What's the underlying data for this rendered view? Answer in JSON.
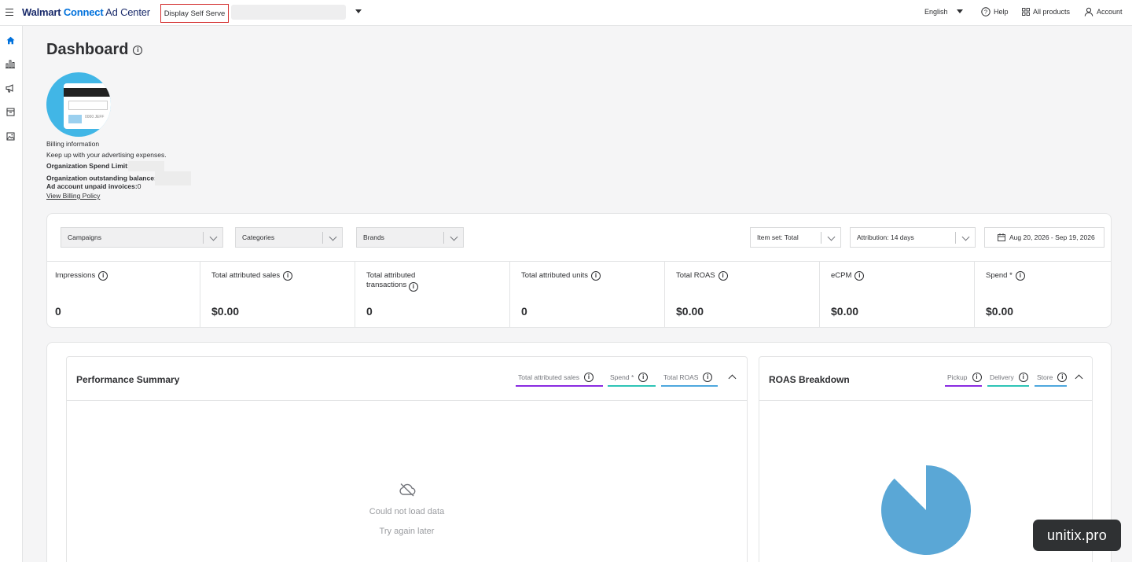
{
  "topbar": {
    "brand_walmart": "Walmart",
    "brand_connect": "Connect",
    "brand_adcenter": "Ad Center",
    "product_selector": "Display Self Serve",
    "language": "English",
    "help": "Help",
    "all_products": "All products",
    "account": "Account"
  },
  "sidebar": {
    "items": [
      {
        "icon": "home-icon"
      },
      {
        "icon": "bar-chart-icon"
      },
      {
        "icon": "megaphone-icon"
      },
      {
        "icon": "inventory-icon"
      },
      {
        "icon": "image-icon"
      }
    ]
  },
  "dashboard": {
    "title": "Dashboard",
    "billing": {
      "card_text": "0000 JEFF",
      "label": "Billing information",
      "description": "Keep up with your advertising expenses.",
      "spend_limit_label": "Organization Spend Limit:",
      "outstanding_label": "Organization outstanding balance:",
      "unpaid_label": "Ad account unpaid invoices:",
      "unpaid_value": "0",
      "policy_link": "View Billing Policy"
    },
    "filters": {
      "campaigns": "Campaigns",
      "categories": "Categories",
      "brands": "Brands",
      "item_set": "Item set: Total",
      "attribution": "Attribution: 14 days",
      "date_range": "Aug 20, 2026 - Sep 19, 2026"
    },
    "metrics": [
      {
        "label": "Impressions",
        "value": "0"
      },
      {
        "label": "Total attributed sales",
        "value": "$0.00"
      },
      {
        "label": "Total attributed transactions",
        "value": "0"
      },
      {
        "label": "Total attributed units",
        "value": "0"
      },
      {
        "label": "Total ROAS",
        "value": "$0.00"
      },
      {
        "label": "eCPM",
        "value": "$0.00"
      },
      {
        "label": "Spend *",
        "value": "$0.00"
      }
    ],
    "performance": {
      "title": "Performance Summary",
      "legend": [
        {
          "label": "Total attributed sales",
          "color": "#8a2be2"
        },
        {
          "label": "Spend *",
          "color": "#2ec4b6"
        },
        {
          "label": "Total ROAS",
          "color": "#4ea8de"
        }
      ],
      "error_title": "Could not load data",
      "error_sub": "Try again later"
    },
    "roas": {
      "title": "ROAS Breakdown",
      "legend": [
        {
          "label": "Pickup",
          "color": "#8a2be2"
        },
        {
          "label": "Delivery",
          "color": "#2ec4b6"
        },
        {
          "label": "Store",
          "color": "#4ea8de"
        }
      ],
      "pie_color": "#5aa7d6"
    }
  },
  "watermark": "unitix.pro"
}
